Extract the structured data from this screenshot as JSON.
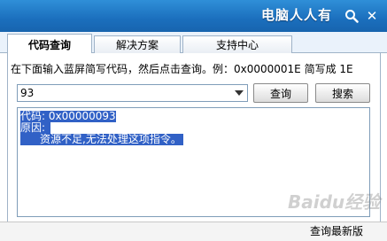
{
  "window": {
    "title": "电脑人人有",
    "accent": "#1b6fbd"
  },
  "tabs": [
    {
      "label": "代码查询",
      "active": true
    },
    {
      "label": "解决方案",
      "active": false
    },
    {
      "label": "支持中心",
      "active": false
    }
  ],
  "query": {
    "instruction": "在下面输入蓝屏简写代码，然后点击查询。例：0x0000001E 简写成 1E",
    "input_value": "93",
    "query_button": "查询",
    "search_button": "搜索"
  },
  "result": {
    "line1": "代码: 0x00000093",
    "line2": "原因:",
    "line3": "资源不足,无法处理这项指令。"
  },
  "footer": {
    "update_link": "查询最新版",
    "watermark": "Baidu经验"
  },
  "icons": {
    "search": "magnifier-icon",
    "close": "close-icon",
    "dropdown": "chevron-down-icon"
  }
}
